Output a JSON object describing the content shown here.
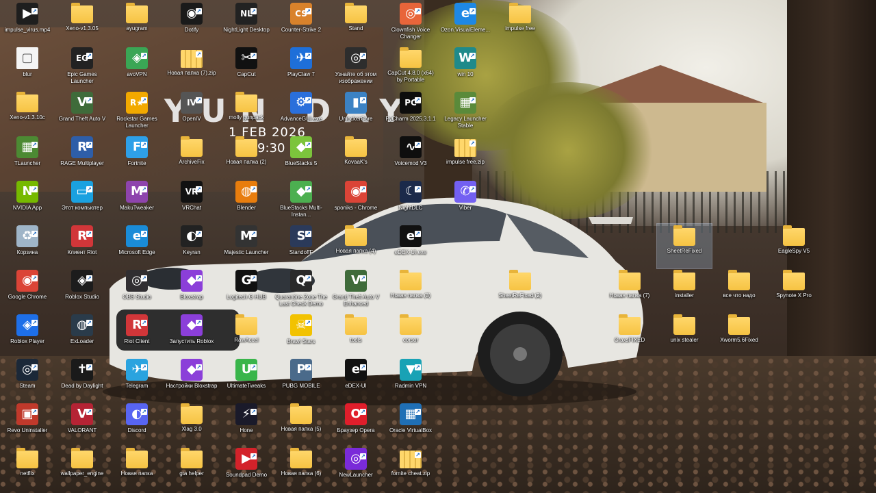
{
  "clock": {
    "logo_text": "YUN DAY",
    "date": "1 FEB 2026",
    "time": "9:30"
  },
  "colors": {
    "folder": "#f6c343",
    "selection": "#aac8eb",
    "label_text": "#ffffff"
  },
  "icons": [
    {
      "label": "impulse_virus.mp4",
      "type": "app",
      "glyph": "▶",
      "color": "#1e1e1e",
      "selected": false
    },
    {
      "label": "Xeno-v1.3.05",
      "type": "folder",
      "glyph": "",
      "color": "#f6c343",
      "selected": false
    },
    {
      "label": "ayugram",
      "type": "folder",
      "glyph": "",
      "color": "#f6c343",
      "selected": false
    },
    {
      "label": "Dotify",
      "type": "app",
      "glyph": "◉",
      "color": "#1a1a1a",
      "selected": false
    },
    {
      "label": "NightLight Desktop",
      "type": "app",
      "glyph": "NL",
      "color": "#222222",
      "selected": false
    },
    {
      "label": "Counter-Strike 2",
      "type": "app",
      "glyph": "CS",
      "color": "#d9822b",
      "selected": false
    },
    {
      "label": "Stand",
      "type": "folder",
      "glyph": "",
      "color": "#f6c343",
      "selected": false
    },
    {
      "label": "Clownfish Voice Changer",
      "type": "app",
      "glyph": "◎",
      "color": "#e8653a",
      "selected": false
    },
    {
      "label": "Ozon.VisualEleme...",
      "type": "app",
      "glyph": "e",
      "color": "#1e88e5",
      "selected": false
    },
    {
      "label": "impulse free",
      "type": "folder",
      "glyph": "",
      "color": "#f6c343",
      "selected": false
    },
    {
      "label": "blur",
      "type": "file",
      "glyph": "▢",
      "color": "#f4f4f4",
      "selected": false
    },
    {
      "label": "Epic Games Launcher",
      "type": "app",
      "glyph": "EG",
      "color": "#222222",
      "selected": false
    },
    {
      "label": "avoVPN",
      "type": "app",
      "glyph": "◈",
      "color": "#3aa655",
      "selected": false
    },
    {
      "label": "Новая папка (7).zip",
      "type": "zipfolder",
      "glyph": "",
      "color": "#f6c343",
      "selected": false
    },
    {
      "label": "CapCut",
      "type": "app",
      "glyph": "✂",
      "color": "#111111",
      "selected": false
    },
    {
      "label": "PlayClaw 7",
      "type": "app",
      "glyph": "✈",
      "color": "#1e6fd9",
      "selected": false
    },
    {
      "label": "Узнайте об этом изображении",
      "type": "app",
      "glyph": "◎",
      "color": "#2d2d2d",
      "selected": false
    },
    {
      "label": "CapCut 4.8.0 (x64) by Portable",
      "type": "folder",
      "glyph": "",
      "color": "#f6c343",
      "selected": false
    },
    {
      "label": "win 10",
      "type": "app",
      "glyph": "W",
      "color": "#1f8a8a",
      "selected": false
    },
    {
      "label": "Xeno-v1.3.10c",
      "type": "folder",
      "glyph": "",
      "color": "#f6c343",
      "selected": false
    },
    {
      "label": "Grand Theft Auto V",
      "type": "app",
      "glyph": "V",
      "color": "#3f6b3a",
      "selected": false
    },
    {
      "label": "Rockstar Games Launcher",
      "type": "app",
      "glyph": "R★",
      "color": "#f2a900",
      "selected": false
    },
    {
      "label": "OpenIV",
      "type": "app",
      "glyph": "IV",
      "color": "#555555",
      "selected": false
    },
    {
      "label": "molly gunpack",
      "type": "folder",
      "glyph": "",
      "color": "#f6c343",
      "selected": false
    },
    {
      "label": "AdvanceGUI.exe",
      "type": "app",
      "glyph": "⚙",
      "color": "#2a6fdb",
      "selected": false
    },
    {
      "label": "UnlockerCore",
      "type": "app",
      "glyph": "▮",
      "color": "#3b82c4",
      "selected": false
    },
    {
      "label": "PyCharm 2025.3.1.1",
      "type": "app",
      "glyph": "PC",
      "color": "#0d0d0d",
      "selected": false
    },
    {
      "label": "Legacy Launcher Stable",
      "type": "app",
      "glyph": "▦",
      "color": "#5a8a3a",
      "selected": false
    },
    {
      "label": "TLauncher",
      "type": "app",
      "glyph": "▦",
      "color": "#4c8a33",
      "selected": false
    },
    {
      "label": "RAGE Multiplayer",
      "type": "app",
      "glyph": "R",
      "color": "#2e5ea8",
      "selected": false
    },
    {
      "label": "Fortnite",
      "type": "app",
      "glyph": "F",
      "color": "#2ea0e8",
      "selected": false
    },
    {
      "label": "ArchiveFix",
      "type": "folder",
      "glyph": "",
      "color": "#f6c343",
      "selected": false
    },
    {
      "label": "Новая папка (2)",
      "type": "folder",
      "glyph": "",
      "color": "#f6c343",
      "selected": false
    },
    {
      "label": "BlueStacks 5",
      "type": "app",
      "glyph": "◆",
      "color": "#7cc43c",
      "selected": false
    },
    {
      "label": "KovaaK's",
      "type": "folder",
      "glyph": "",
      "color": "#f6c343",
      "selected": false
    },
    {
      "label": "Voicemod V3",
      "type": "app",
      "glyph": "∿",
      "color": "#0e0e0e",
      "selected": false
    },
    {
      "label": "impulse free.zip",
      "type": "zipfolder",
      "glyph": "",
      "color": "#f6c343",
      "selected": false
    },
    {
      "label": "NVIDIA App",
      "type": "app",
      "glyph": "N",
      "color": "#76b900",
      "selected": false
    },
    {
      "label": "Этот компьютер",
      "type": "app",
      "glyph": "▭",
      "color": "#1aa1e0",
      "selected": false
    },
    {
      "label": "MakuTweaker",
      "type": "app",
      "glyph": "M",
      "color": "#8e44ad",
      "selected": false
    },
    {
      "label": "VRChat",
      "type": "app",
      "glyph": "VR",
      "color": "#111111",
      "selected": false
    },
    {
      "label": "Blender",
      "type": "app",
      "glyph": "◍",
      "color": "#e87d0d",
      "selected": false
    },
    {
      "label": "BlueStacks Multi-Instan...",
      "type": "app",
      "glyph": "◆",
      "color": "#4caf50",
      "selected": false
    },
    {
      "label": "sponiks - Chrome",
      "type": "app",
      "glyph": "◉",
      "color": "#db4437",
      "selected": false
    },
    {
      "label": "NightDLC",
      "type": "app",
      "glyph": "☾",
      "color": "#1b2a4a",
      "selected": false
    },
    {
      "label": "Viber",
      "type": "app",
      "glyph": "✆",
      "color": "#7360f2",
      "selected": false
    },
    {
      "label": "Корзина",
      "type": "app",
      "glyph": "♻",
      "color": "#9fb5c8",
      "selected": false
    },
    {
      "label": "Клиент Riot",
      "type": "app",
      "glyph": "R",
      "color": "#d13639",
      "selected": false
    },
    {
      "label": "Microsoft Edge",
      "type": "app",
      "glyph": "e",
      "color": "#1a8cd8",
      "selected": false
    },
    {
      "label": "Keyran",
      "type": "app",
      "glyph": "◐",
      "color": "#222222",
      "selected": false
    },
    {
      "label": "Majestic Launcher",
      "type": "app",
      "glyph": "M",
      "color": "#333333",
      "selected": false
    },
    {
      "label": "StandoffF",
      "type": "app",
      "glyph": "S",
      "color": "#2b3a5a",
      "selected": false
    },
    {
      "label": "Новая папка (4)",
      "type": "folder",
      "glyph": "",
      "color": "#f6c343",
      "selected": false
    },
    {
      "label": "eDEX-UI.exe",
      "type": "app",
      "glyph": "e",
      "color": "#111111",
      "selected": false
    },
    {
      "label": "SheetReFixed",
      "type": "folder",
      "glyph": "",
      "color": "#f6c343",
      "selected": true
    },
    {
      "label": "EagleSpy V5",
      "type": "folder",
      "glyph": "",
      "color": "#f6c343",
      "selected": false
    },
    {
      "label": "Google Chrome",
      "type": "app",
      "glyph": "◉",
      "color": "#db4437",
      "selected": false
    },
    {
      "label": "Roblox Studio",
      "type": "app",
      "glyph": "◈",
      "color": "#1c1c1c",
      "selected": false
    },
    {
      "label": "OBS Studio",
      "type": "app",
      "glyph": "◎",
      "color": "#302e31",
      "selected": false
    },
    {
      "label": "Bloxstrap",
      "type": "app",
      "glyph": "◆",
      "color": "#8b3fd9",
      "selected": false
    },
    {
      "label": "Logitech G HUB",
      "type": "app",
      "glyph": "G",
      "color": "#111111",
      "selected": false
    },
    {
      "label": "Quarantine Zone The Last Check Demo",
      "type": "app",
      "glyph": "Q",
      "color": "#2a2a2a",
      "selected": false
    },
    {
      "label": "Grand Theft Auto V Enhanced",
      "type": "app",
      "glyph": "V",
      "color": "#3f6b3a",
      "selected": false
    },
    {
      "label": "Новая папка (3)",
      "type": "folder",
      "glyph": "",
      "color": "#f6c343",
      "selected": false
    },
    {
      "label": "SheetReFixed (2)",
      "type": "folder",
      "glyph": "",
      "color": "#f6c343",
      "selected": false
    },
    {
      "label": "Новая папка (7)",
      "type": "folder",
      "glyph": "",
      "color": "#f6c343",
      "selected": false
    },
    {
      "label": "installer",
      "type": "folder",
      "glyph": "",
      "color": "#f6c343",
      "selected": false
    },
    {
      "label": "все что надо",
      "type": "folder",
      "glyph": "",
      "color": "#f6c343",
      "selected": false
    },
    {
      "label": "Spynote X Pro",
      "type": "folder",
      "glyph": "",
      "color": "#f6c343",
      "selected": false
    },
    {
      "label": "Roblox Player",
      "type": "app",
      "glyph": "◈",
      "color": "#1e6fe8",
      "selected": false
    },
    {
      "label": "ExLoader",
      "type": "app",
      "glyph": "◍",
      "color": "#2a3b4a",
      "selected": false
    },
    {
      "label": "Riot Client",
      "type": "app",
      "glyph": "R",
      "color": "#d13639",
      "selected": false
    },
    {
      "label": "Запустить Roblox",
      "type": "app",
      "glyph": "◆",
      "color": "#8b3fd9",
      "selected": false
    },
    {
      "label": "RawAccel",
      "type": "folder",
      "glyph": "",
      "color": "#f6c343",
      "selected": false
    },
    {
      "label": "Brawl Stars",
      "type": "app",
      "glyph": "☠",
      "color": "#f2c200",
      "selected": false
    },
    {
      "label": "tools",
      "type": "folder",
      "glyph": "",
      "color": "#f6c343",
      "selected": false
    },
    {
      "label": "corsor",
      "type": "folder",
      "glyph": "",
      "color": "#f6c343",
      "selected": false
    },
    {
      "label": "CraxsFIXED",
      "type": "folder",
      "glyph": "",
      "color": "#f6c343",
      "selected": false
    },
    {
      "label": "unix stealer",
      "type": "folder",
      "glyph": "",
      "color": "#f6c343",
      "selected": false
    },
    {
      "label": "Xworm5.6Fixed",
      "type": "folder",
      "glyph": "",
      "color": "#f6c343",
      "selected": false
    },
    {
      "label": "Steam",
      "type": "app",
      "glyph": "◎",
      "color": "#1b2838",
      "selected": false
    },
    {
      "label": "Dead by Daylight",
      "type": "app",
      "glyph": "✝",
      "color": "#1a1a1a",
      "selected": false
    },
    {
      "label": "Telegram",
      "type": "app",
      "glyph": "✈",
      "color": "#2aa3df",
      "selected": false
    },
    {
      "label": "Настройки Bloxstrap",
      "type": "app",
      "glyph": "◆",
      "color": "#8b3fd9",
      "selected": false
    },
    {
      "label": "UltimateTweaks",
      "type": "app",
      "glyph": "U",
      "color": "#39b54a",
      "selected": false
    },
    {
      "label": "PUBG MOBILE",
      "type": "app",
      "glyph": "P",
      "color": "#4a6a8a",
      "selected": false
    },
    {
      "label": "eDEX-UI",
      "type": "app",
      "glyph": "e",
      "color": "#111111",
      "selected": false
    },
    {
      "label": "Radmin VPN",
      "type": "app",
      "glyph": "▼",
      "color": "#19a2b5",
      "selected": false
    },
    {
      "label": "Revo Uninstaller",
      "type": "app",
      "glyph": "▣",
      "color": "#c0392b",
      "selected": false
    },
    {
      "label": "VALORANT",
      "type": "app",
      "glyph": "V",
      "color": "#b52334",
      "selected": false
    },
    {
      "label": "Discord",
      "type": "app",
      "glyph": "◐",
      "color": "#5865f2",
      "selected": false
    },
    {
      "label": "Xlag 3.0",
      "type": "folder",
      "glyph": "",
      "color": "#f6c343",
      "selected": false
    },
    {
      "label": "Hone",
      "type": "app",
      "glyph": "⚡",
      "color": "#1a1a2a",
      "selected": false
    },
    {
      "label": "Новая папка (5)",
      "type": "folder",
      "glyph": "",
      "color": "#f6c343",
      "selected": false
    },
    {
      "label": "Браузер Opera",
      "type": "app",
      "glyph": "O",
      "color": "#e01e2b",
      "selected": false
    },
    {
      "label": "Oracle VirtualBox",
      "type": "app",
      "glyph": "▦",
      "color": "#1f6fb5",
      "selected": false
    },
    {
      "label": "netflix",
      "type": "folder",
      "glyph": "",
      "color": "#f6c343",
      "selected": false
    },
    {
      "label": "wallpaper_engine",
      "type": "folder",
      "glyph": "",
      "color": "#f6c343",
      "selected": false
    },
    {
      "label": "Новая папка",
      "type": "folder",
      "glyph": "",
      "color": "#f6c343",
      "selected": false
    },
    {
      "label": "gta helper",
      "type": "folder",
      "glyph": "",
      "color": "#f6c343",
      "selected": false
    },
    {
      "label": "Soundpad Demo",
      "type": "app",
      "glyph": "▶",
      "color": "#d3222a",
      "selected": false
    },
    {
      "label": "Новая папка (6)",
      "type": "folder",
      "glyph": "",
      "color": "#f6c343",
      "selected": false
    },
    {
      "label": "NewLauncher",
      "type": "app",
      "glyph": "◎",
      "color": "#7a2bd9",
      "selected": false
    },
    {
      "label": "fornite cheat.zip",
      "type": "zipfolder",
      "glyph": "",
      "color": "#f6c343",
      "selected": false
    }
  ]
}
